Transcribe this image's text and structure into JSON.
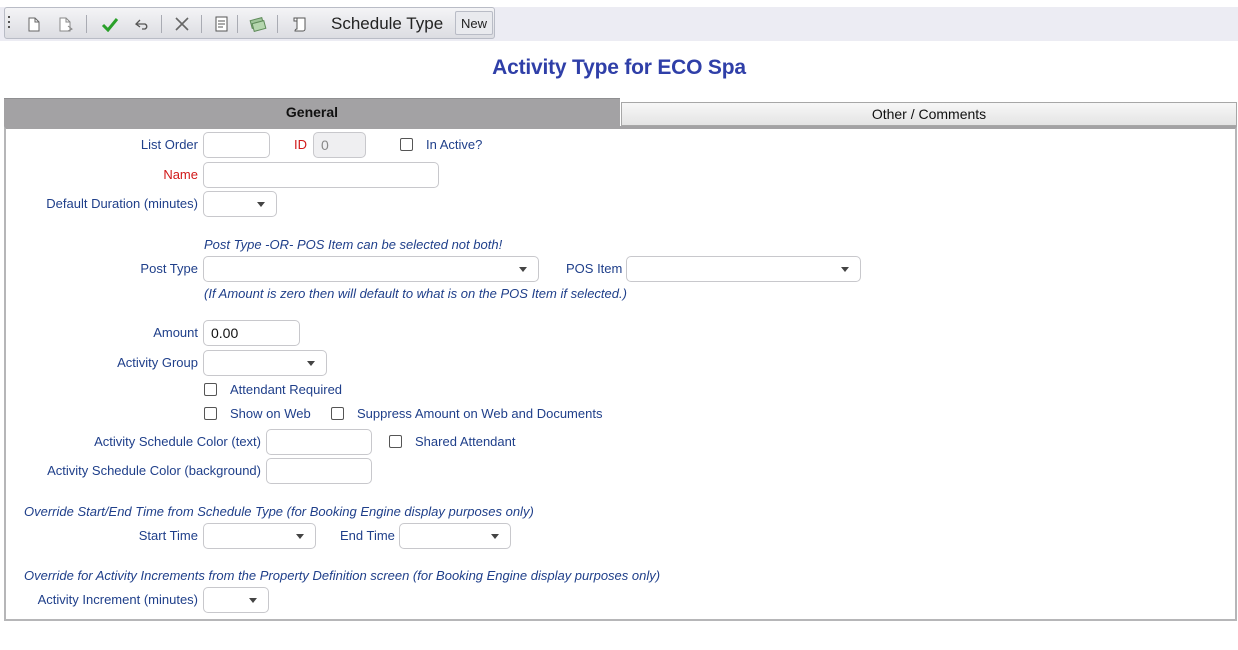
{
  "toolbar": {
    "title": "Schedule Type",
    "new_label": "New",
    "icons": [
      "grip-icon",
      "new-document-icon",
      "copy-document-icon",
      "check-icon",
      "undo-icon",
      "delete-icon",
      "report-icon",
      "money-icon",
      "scroll-icon"
    ],
    "colors": {
      "check": "#2aa02a"
    }
  },
  "page": {
    "title": "Activity Type for ECO Spa"
  },
  "tabs": [
    {
      "label": "General",
      "active": true
    },
    {
      "label": "Other / Comments",
      "active": false
    }
  ],
  "form": {
    "list_order_label": "List Order",
    "list_order_value": "",
    "id_label": "ID",
    "id_value": "0",
    "inactive_label": "In Active?",
    "name_label": "Name",
    "name_value": "",
    "default_duration_label": "Default Duration (minutes)",
    "post_note": "Post Type -OR- POS Item can be selected not both!",
    "post_type_label": "Post Type",
    "pos_item_label": "POS Item",
    "amount_note": "(If Amount is zero then will default to what is on the POS Item if selected.)",
    "amount_label": "Amount",
    "amount_value": "0.00",
    "activity_group_label": "Activity Group",
    "attendant_required_label": "Attendant Required",
    "show_on_web_label": "Show on Web",
    "suppress_amount_label": "Suppress Amount on Web and Documents",
    "color_text_label": "Activity Schedule Color (text)",
    "shared_attendant_label": "Shared Attendant",
    "color_bg_label": "Activity Schedule Color (background)",
    "override_time_note": "Override Start/End Time from Schedule Type (for Booking Engine display purposes only)",
    "start_time_label": "Start Time",
    "end_time_label": "End Time",
    "override_increment_note": "Override for Activity Increments from the Property Definition screen (for Booking Engine display purposes only)",
    "increment_label": "Activity Increment (minutes)"
  },
  "colors": {
    "label": "#1f3f8a",
    "required": "#d11818",
    "title": "#2f3fa8",
    "active_tab": "#a3a2a4"
  }
}
